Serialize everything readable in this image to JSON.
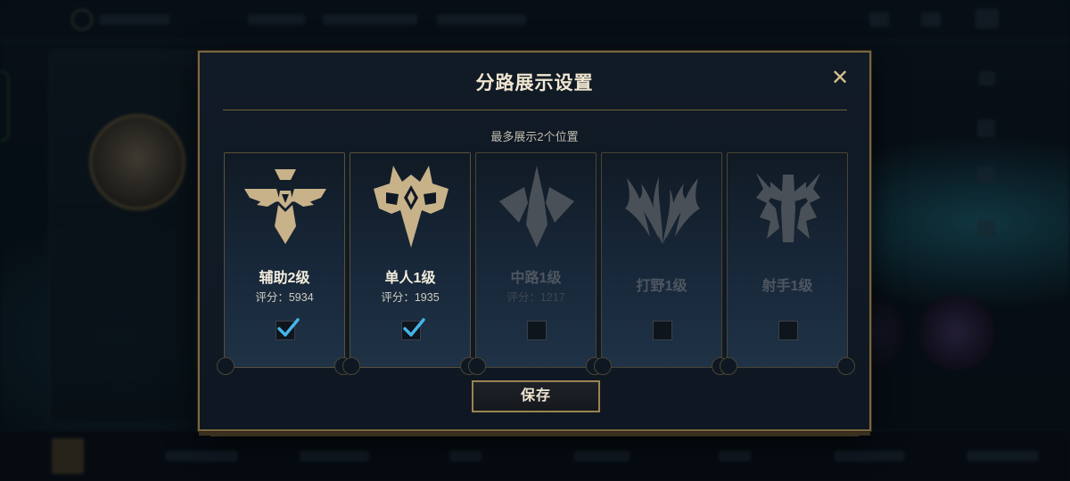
{
  "dialog": {
    "title": "分路展示设置",
    "close_glyph": "✕",
    "subtitle": "最多展示2个位置",
    "save_label": "保存"
  },
  "lanes": [
    {
      "name": "辅助2级",
      "score_label": "评分：",
      "score": "5934",
      "checked": true,
      "active": true,
      "icon": "support-emblem-icon"
    },
    {
      "name": "单人1级",
      "score_label": "评分：",
      "score": "1935",
      "checked": true,
      "active": true,
      "icon": "solo-emblem-icon"
    },
    {
      "name": "中路1级",
      "score_label": "评分：",
      "score": "1217",
      "checked": false,
      "active": false,
      "icon": "mid-emblem-icon"
    },
    {
      "name": "打野1级",
      "score_label": "",
      "score": "",
      "checked": false,
      "active": false,
      "icon": "jungle-emblem-icon"
    },
    {
      "name": "射手1级",
      "score_label": "",
      "score": "",
      "checked": false,
      "active": false,
      "icon": "marksman-emblem-icon"
    }
  ],
  "colors": {
    "gold": "#c8b28a",
    "inactive_icon": "#4a5058",
    "check_blue": "#46b4ea",
    "border_gold": "#7a6842"
  }
}
